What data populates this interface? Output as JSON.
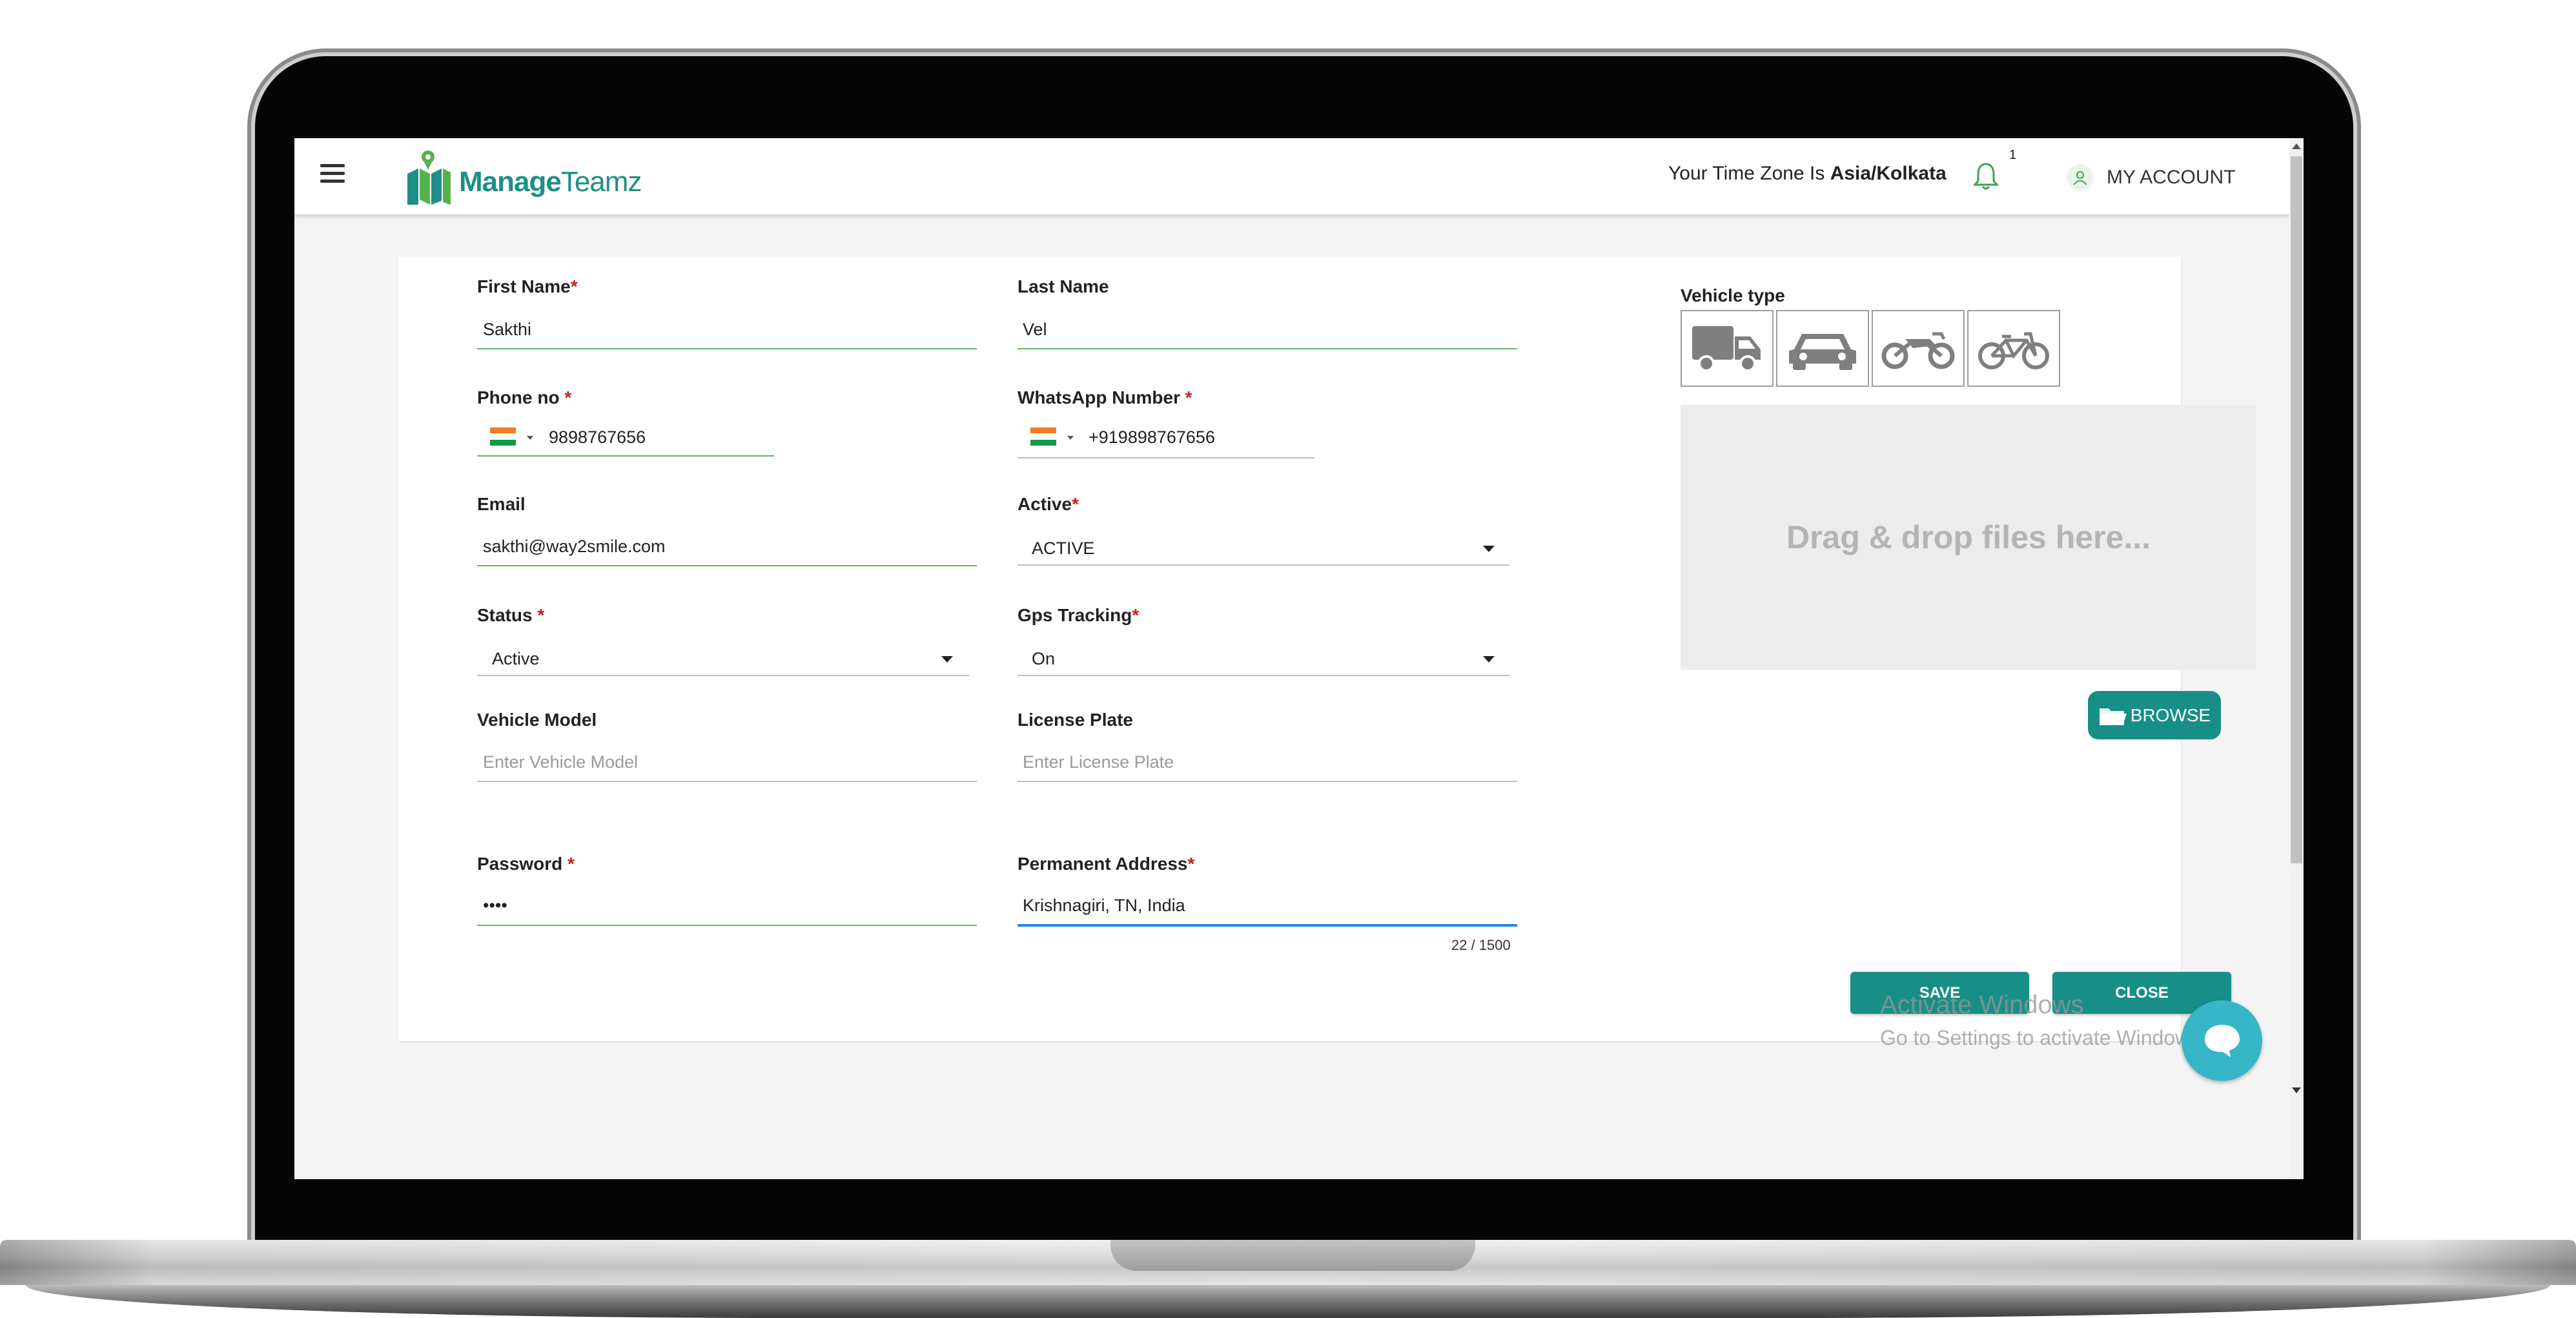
{
  "app": {
    "logo_bold": "Manage",
    "logo_rest": "Teamz"
  },
  "header": {
    "timezone_prefix": "Your Time Zone Is ",
    "timezone_value": "Asia/Kolkata",
    "notification_count": "1",
    "account_label": "MY ACCOUNT"
  },
  "form": {
    "first_name": {
      "label": "First Name",
      "required": "*",
      "value": "Sakthi"
    },
    "last_name": {
      "label": "Last Name",
      "value": "Vel"
    },
    "phone": {
      "label": "Phone no ",
      "required": "*",
      "value": "9898767656"
    },
    "whatsapp": {
      "label": "WhatsApp Number ",
      "required": "*",
      "value": "+919898767656"
    },
    "email": {
      "label": "Email",
      "value": "sakthi@way2smile.com"
    },
    "active": {
      "label": "Active",
      "required": "*",
      "value": "ACTIVE"
    },
    "status": {
      "label": "Status ",
      "required": "*",
      "value": "Active"
    },
    "gps": {
      "label": "Gps Tracking",
      "required": "*",
      "value": "On"
    },
    "vehicle_model": {
      "label": "Vehicle Model",
      "placeholder": "Enter Vehicle Model"
    },
    "license_plate": {
      "label": "License Plate",
      "placeholder": "Enter License Plate"
    },
    "password": {
      "label": "Password ",
      "required": "*",
      "value": "••••"
    },
    "address": {
      "label": "Permanent Address",
      "required": "*",
      "value": "Krishnagiri, TN, India",
      "counter": "22 / 1500"
    }
  },
  "vehicle": {
    "label": "Vehicle type",
    "types": [
      "truck-icon",
      "car-icon",
      "motorbike-icon",
      "bicycle-icon"
    ]
  },
  "upload": {
    "dropzone_text": "Drag & drop files here...",
    "browse_label": "BROWSE"
  },
  "actions": {
    "save_label": "SAVE",
    "close_label": "CLOSE"
  },
  "watermark": {
    "line1": "Activate Windows",
    "line2": "Go to Settings to activate Windows."
  },
  "colors": {
    "brand": "#178f87",
    "required": "#d01e1e",
    "chat": "#37b6c8"
  }
}
